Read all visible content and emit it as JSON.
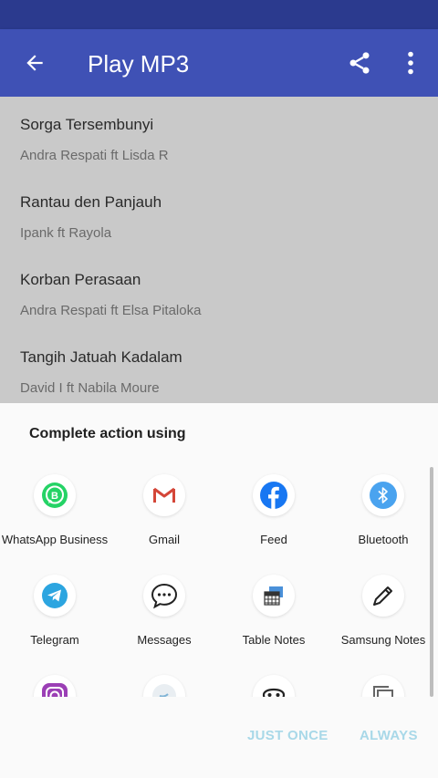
{
  "appbar": {
    "title": "Play MP3"
  },
  "songs": [
    {
      "title": "Sorga Tersembunyi",
      "artist": "Andra Respati ft Lisda R"
    },
    {
      "title": "Rantau den Panjauh",
      "artist": "Ipank ft Rayola"
    },
    {
      "title": "Korban Perasaan",
      "artist": "Andra Respati ft Elsa Pitaloka"
    },
    {
      "title": "Tangih Jatuah Kadalam",
      "artist": "David I ft Nabila Moure"
    }
  ],
  "sheet": {
    "title": "Complete action using",
    "apps": [
      {
        "label": "WhatsApp Business",
        "icon": "whatsapp-business-icon"
      },
      {
        "label": "Gmail",
        "icon": "gmail-icon"
      },
      {
        "label": "Feed",
        "icon": "facebook-icon"
      },
      {
        "label": "Bluetooth",
        "icon": "bluetooth-icon"
      },
      {
        "label": "Telegram",
        "icon": "telegram-icon"
      },
      {
        "label": "Messages",
        "icon": "messages-icon"
      },
      {
        "label": "Table Notes",
        "icon": "table-notes-icon"
      },
      {
        "label": "Samsung Notes",
        "icon": "samsung-notes-icon"
      },
      {
        "label": "",
        "icon": "instagram-icon"
      },
      {
        "label": "",
        "icon": "twitter-icon"
      },
      {
        "label": "",
        "icon": "mask-icon"
      },
      {
        "label": "",
        "icon": "copy-icon"
      }
    ],
    "just_once": "JUST ONCE",
    "always": "ALWAYS"
  },
  "colors": {
    "primary": "#3f51b5",
    "primary_dark": "#2b3a8e",
    "dim_background": "#c9c9c9",
    "button_disabled": "#a8d8e8"
  }
}
